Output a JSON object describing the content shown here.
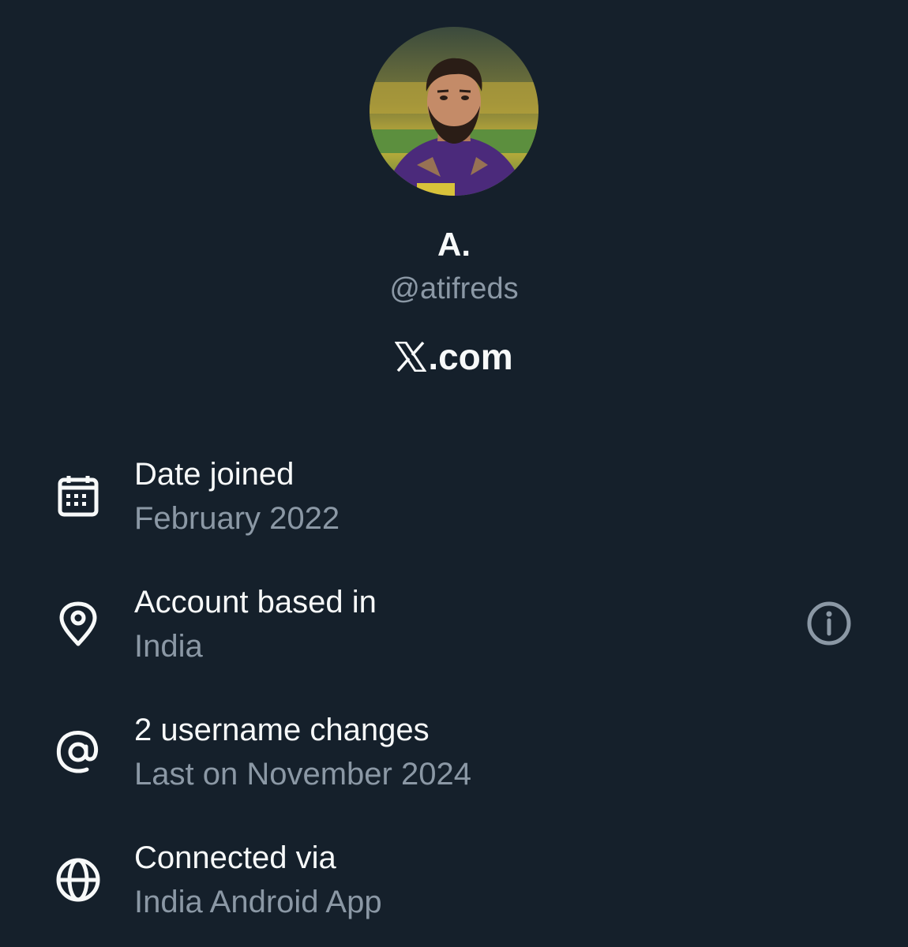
{
  "profile": {
    "display_name": "A.",
    "handle": "@atifreds",
    "brand_text": ".com",
    "avatar_icon": "profile-photo"
  },
  "details": [
    {
      "icon": "calendar-icon",
      "title": "Date joined",
      "value": "February 2022"
    },
    {
      "icon": "location-pin-icon",
      "title": "Account based in",
      "value": "India",
      "has_info": true
    },
    {
      "icon": "at-sign-icon",
      "title": "2 username changes",
      "value": "Last on November 2024"
    },
    {
      "icon": "globe-icon",
      "title": "Connected via",
      "value": "India Android App"
    }
  ],
  "colors": {
    "background": "#15202b",
    "primary_text": "#f7f9f9",
    "secondary_text": "#8b98a5"
  }
}
